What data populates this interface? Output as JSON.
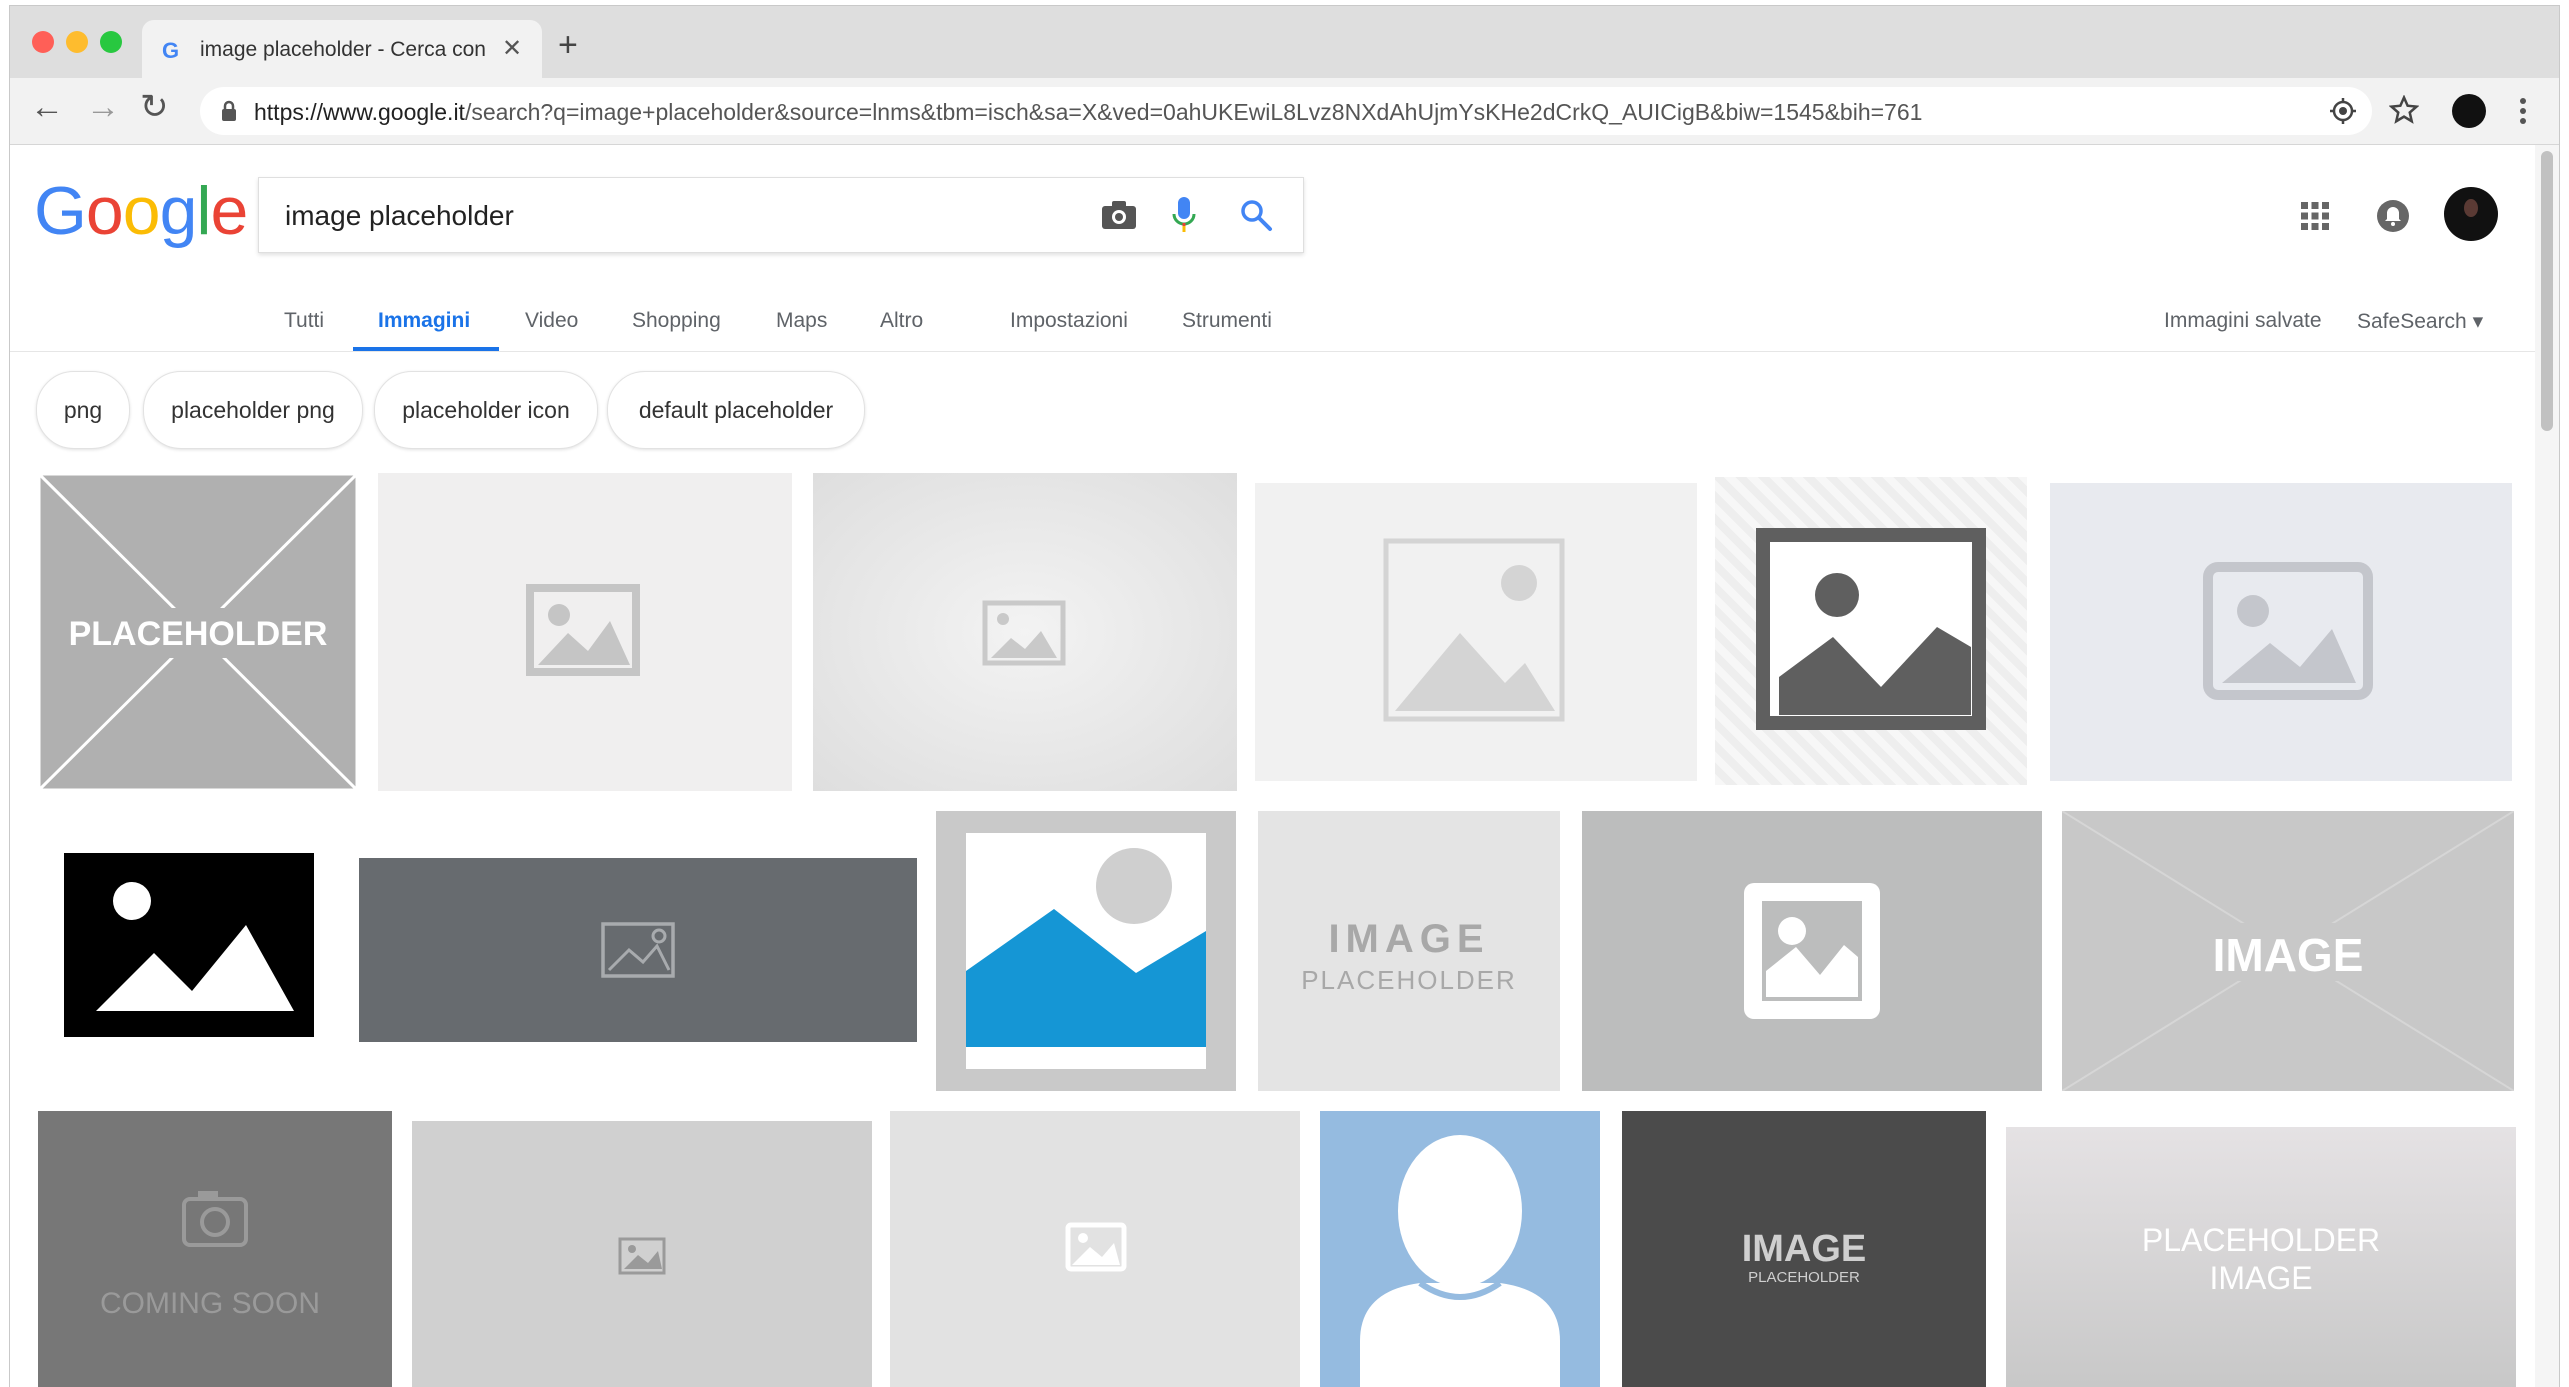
{
  "browser": {
    "tab_title": "image placeholder - Cerca con Google",
    "tab_favicon": "G",
    "tab_close": "✕",
    "new_tab": "+",
    "url_host": "https://www.google.it",
    "url_path": "/search?q=image+placeholder&source=lnms&tbm=isch&sa=X&ved=0ahUKEwiL8Lvz8NXdAhUjmYsKHe2dCrkQ_AUICigB&biw=1545&bih=761"
  },
  "search": {
    "logo": [
      "G",
      "o",
      "o",
      "g",
      "l",
      "e"
    ],
    "logo_colors": [
      "#4285f4",
      "#ea4335",
      "#fbbc05",
      "#4285f4",
      "#34a853",
      "#ea4335"
    ],
    "query": "image placeholder"
  },
  "nav": {
    "items": [
      "Tutti",
      "Immagini",
      "Video",
      "Shopping",
      "Maps",
      "Altro",
      "Impostazioni",
      "Strumenti"
    ],
    "active": "Immagini",
    "right": [
      "Immagini salvate",
      "SafeSearch ▾"
    ]
  },
  "chips": [
    "png",
    "placeholder png",
    "placeholder icon",
    "default placeholder"
  ],
  "tiles": {
    "placeholder_x": "PLACEHOLDER",
    "image_placeholder_1": "IMAGE",
    "image_placeholder_2": "PLACEHOLDER",
    "image_x": "IMAGE",
    "coming_soon": "COMING SOON",
    "image_dark_1": "IMAGE",
    "image_dark_2": "PLACEHOLDER",
    "placeholder_image_1": "PLACEHOLDER",
    "placeholder_image_2": "IMAGE"
  },
  "colors": {
    "accent": "#1a73e8",
    "traffic_red": "#ff5f57",
    "traffic_yellow": "#febc2e",
    "traffic_green": "#28c840"
  }
}
